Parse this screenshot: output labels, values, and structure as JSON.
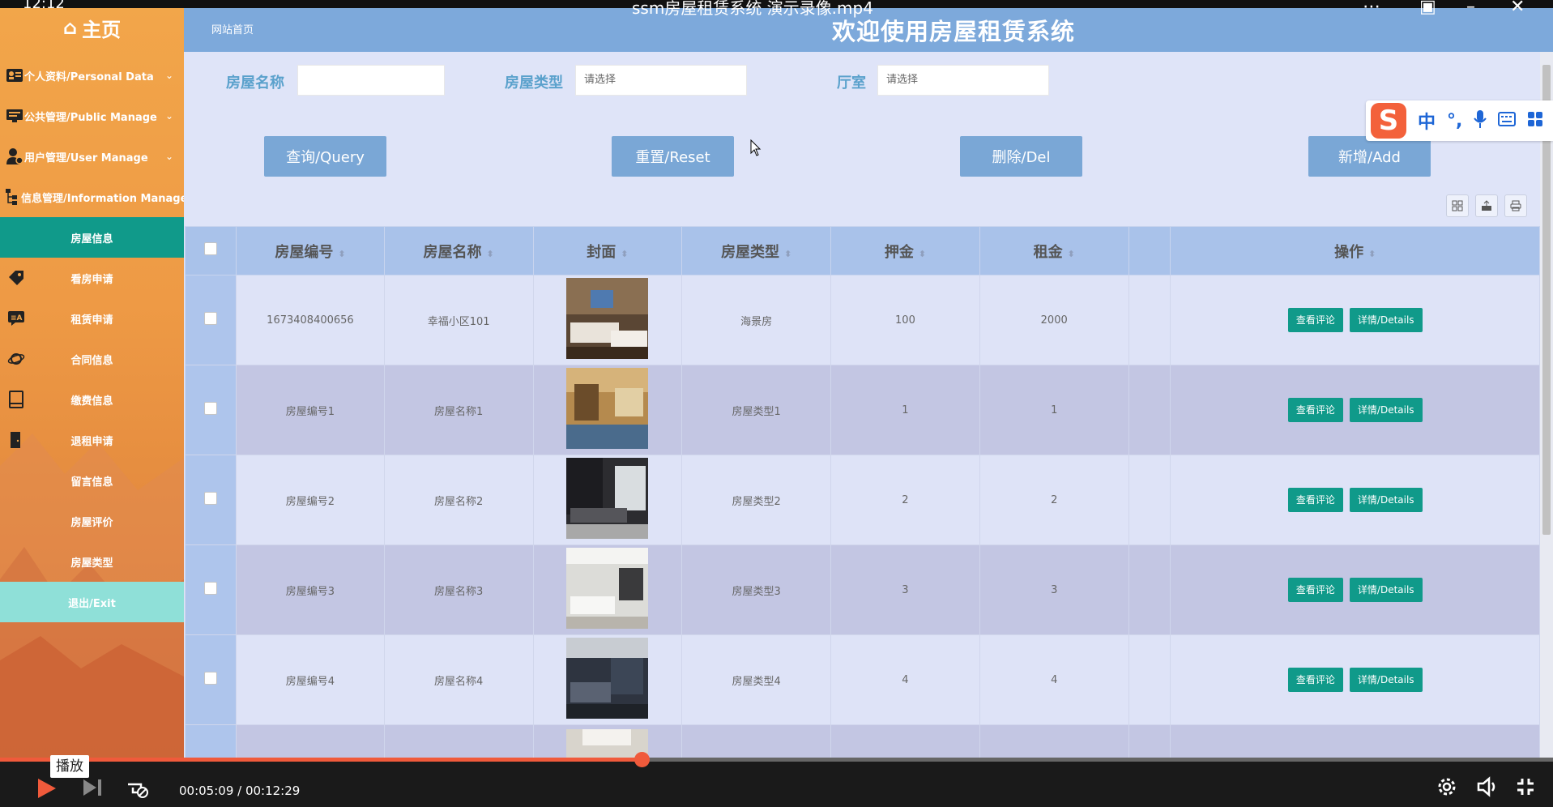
{
  "video": {
    "clock": "12:12",
    "title": "ssm房屋租赁系统 演示录像.mp4",
    "time_current": "00:05:09",
    "time_total": "00:12:29",
    "time_display": "00:05:09 / 00:12:29",
    "progress_fraction": 0.413,
    "tooltip": "播放",
    "accent_color": "#f05a3b"
  },
  "sidebar": {
    "home_label": "主页",
    "groups": [
      {
        "label": "个人资料/Personal Data",
        "icon": "id-card-icon"
      },
      {
        "label": "公共管理/Public Manage",
        "icon": "monitor-icon"
      },
      {
        "label": "用户管理/User Manage",
        "icon": "user-gear-icon"
      },
      {
        "label": "信息管理/Information Manage",
        "icon": "sitemap-icon"
      }
    ],
    "subitems": [
      {
        "label": "房屋信息",
        "icon": ""
      },
      {
        "label": "看房申请",
        "icon": "tag-icon"
      },
      {
        "label": "租赁申请",
        "icon": "message-icon"
      },
      {
        "label": "合同信息",
        "icon": "planet-icon"
      },
      {
        "label": "缴费信息",
        "icon": "book-icon"
      },
      {
        "label": "退租申请",
        "icon": "door-icon"
      },
      {
        "label": "留言信息",
        "icon": ""
      },
      {
        "label": "房屋评价",
        "icon": ""
      },
      {
        "label": "房屋类型",
        "icon": ""
      },
      {
        "label": "退出/Exit",
        "icon": ""
      }
    ],
    "active_color": "#109a8a"
  },
  "header": {
    "breadcrumb": "网站首页",
    "title": "欢迎使用房屋租赁系统"
  },
  "search": {
    "name_label": "房屋名称",
    "name_value": "",
    "type_label": "房屋类型",
    "type_placeholder": "请选择",
    "room_label": "厅室",
    "room_placeholder": "请选择"
  },
  "buttons": {
    "query": "查询/Query",
    "reset": "重置/Reset",
    "delete": "删除/Del",
    "add": "新增/Add"
  },
  "table": {
    "columns": [
      "房屋编号",
      "房屋名称",
      "封面",
      "房屋类型",
      "押金",
      "租金",
      "",
      "操作"
    ],
    "rows": [
      {
        "id": "1673408400656",
        "name": "幸福小区101",
        "type": "海景房",
        "deposit": "100",
        "rent": "2000"
      },
      {
        "id": "房屋编号1",
        "name": "房屋名称1",
        "type": "房屋类型1",
        "deposit": "1",
        "rent": "1"
      },
      {
        "id": "房屋编号2",
        "name": "房屋名称2",
        "type": "房屋类型2",
        "deposit": "2",
        "rent": "2"
      },
      {
        "id": "房屋编号3",
        "name": "房屋名称3",
        "type": "房屋类型3",
        "deposit": "3",
        "rent": "3"
      },
      {
        "id": "房屋编号4",
        "name": "房屋名称4",
        "type": "房屋类型4",
        "deposit": "4",
        "rent": "4"
      }
    ],
    "action_comment": "查看评论",
    "action_details": "详情/Details"
  },
  "ime": {
    "logo": "S",
    "lang": "中",
    "punct": "°,"
  }
}
